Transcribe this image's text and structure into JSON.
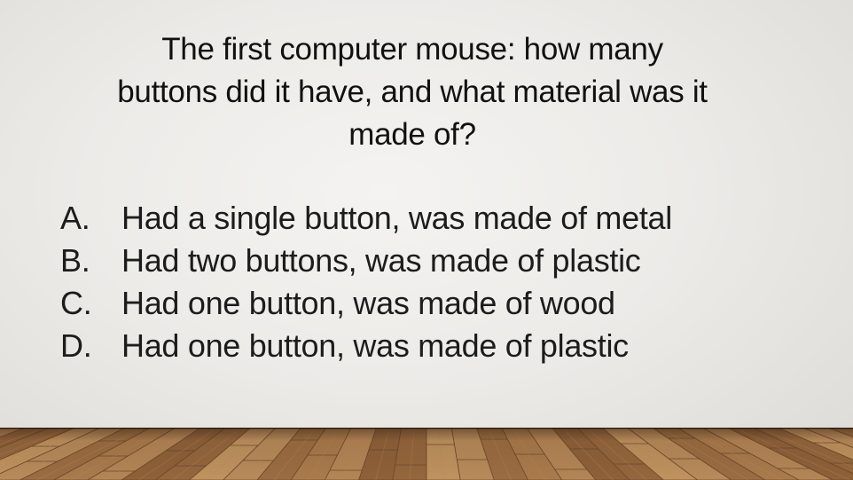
{
  "slide": {
    "question_lines": [
      "The first computer mouse: how many",
      "buttons did it have, and what material was it",
      "made of?"
    ],
    "answers": [
      {
        "letter": "A.",
        "text": "Had a single button, was made of metal"
      },
      {
        "letter": "B.",
        "text": "Had two buttons, was made of plastic"
      },
      {
        "letter": "C.",
        "text": "Had one button, was made of wood"
      },
      {
        "letter": "D.",
        "text": "Had one button, was made of plastic"
      }
    ]
  },
  "theme": {
    "background": "#ecebe8",
    "text_color": "#111111",
    "wood_light": "#b98a5c",
    "wood_dark": "#6e4a2c"
  }
}
